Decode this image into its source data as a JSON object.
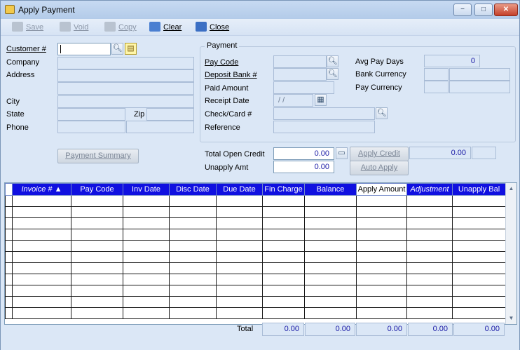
{
  "window": {
    "title": "Apply Payment",
    "minimize_glyph": "−",
    "maximize_glyph": "□",
    "close_glyph": "✕"
  },
  "toolbar": {
    "save": "Save",
    "void": "Void",
    "copy": "Copy",
    "clear": "Clear",
    "close": "Close"
  },
  "customer": {
    "customer_no_label": "Customer #",
    "company_label": "Company",
    "address_label": "Address",
    "city_label": "City",
    "state_label": "State",
    "zip_label": "Zip",
    "phone_label": "Phone",
    "customer_no_value": "",
    "payment_summary_button": "Payment Summary"
  },
  "payment": {
    "group_title": "Payment",
    "pay_code_label": "Pay Code",
    "deposit_bank_label": "Deposit Bank #",
    "paid_amount_label": "Paid Amount",
    "receipt_date_label": "Receipt Date",
    "receipt_date_value": " / /",
    "check_card_label": "Check/Card #",
    "reference_label": "Reference",
    "avg_pay_days_label": "Avg Pay Days",
    "avg_pay_days_value": "0",
    "bank_currency_label": "Bank Currency",
    "pay_currency_label": "Pay Currency"
  },
  "credit": {
    "total_open_credit_label": "Total Open Credit",
    "total_open_credit_value": "0.00",
    "unapply_amt_label": "Unapply Amt",
    "unapply_amt_value": "0.00",
    "apply_credit_button": "Apply Credit",
    "apply_credit_value": "0.00",
    "auto_apply_button": "Auto Apply"
  },
  "grid": {
    "columns": [
      "Invoice # ▲",
      "Pay Code",
      "Inv Date",
      "Disc Date",
      "Due Date",
      "Fin Charge",
      "Balance",
      "Apply Amount",
      "Adjustment",
      "Unapply Bal"
    ],
    "row_count": 11
  },
  "totals": {
    "label": "Total",
    "fin_charge": "0.00",
    "balance": "0.00",
    "apply_amount": "0.00",
    "adjustment": "0.00",
    "unapply_bal": "0.00"
  },
  "colors": {
    "header_blue": "#1010e0",
    "value_blue": "#1a1aa6",
    "form_bg": "#dbe7f6"
  },
  "icons": [
    "app-icon",
    "save-icon",
    "void-icon",
    "copy-icon",
    "clear-icon",
    "close-icon",
    "search-icon",
    "note-icon",
    "calendar-icon"
  ]
}
